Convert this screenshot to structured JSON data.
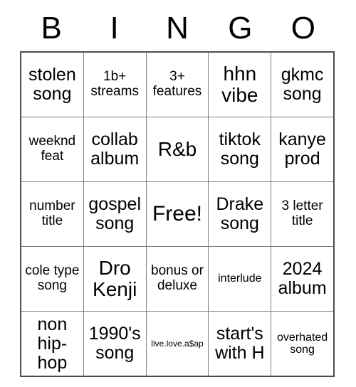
{
  "card": {
    "header": {
      "letters": [
        "B",
        "I",
        "N",
        "G",
        "O"
      ]
    },
    "rows": [
      [
        {
          "text": "stolen song",
          "size": "md"
        },
        {
          "text": "1b+ streams",
          "size": "sm"
        },
        {
          "text": "3+ features",
          "size": "sm"
        },
        {
          "text": "hhn vibe",
          "size": "lg"
        },
        {
          "text": "gkmc song",
          "size": "md"
        }
      ],
      [
        {
          "text": "weeknd feat",
          "size": "sm"
        },
        {
          "text": "collab album",
          "size": "md"
        },
        {
          "text": "R&b",
          "size": "lg"
        },
        {
          "text": "tiktok song",
          "size": "md"
        },
        {
          "text": "kanye prod",
          "size": "md"
        }
      ],
      [
        {
          "text": "number title",
          "size": "sm"
        },
        {
          "text": "gospel song",
          "size": "md"
        },
        {
          "text": "Free!",
          "size": "xl"
        },
        {
          "text": "Drake song",
          "size": "md"
        },
        {
          "text": "3 letter title",
          "size": "sm"
        }
      ],
      [
        {
          "text": "cole type song",
          "size": "sm"
        },
        {
          "text": "Dro Kenji",
          "size": "lg"
        },
        {
          "text": "bonus or deluxe",
          "size": "sm"
        },
        {
          "text": "interlude",
          "size": "xs"
        },
        {
          "text": "2024 album",
          "size": "md"
        }
      ],
      [
        {
          "text": "non hip-hop",
          "size": "md"
        },
        {
          "text": "1990's song",
          "size": "md"
        },
        {
          "text": "live.love.a$ap",
          "size": "xxs"
        },
        {
          "text": "start's with H",
          "size": "md"
        },
        {
          "text": "overhated song",
          "size": "xs"
        }
      ]
    ]
  }
}
